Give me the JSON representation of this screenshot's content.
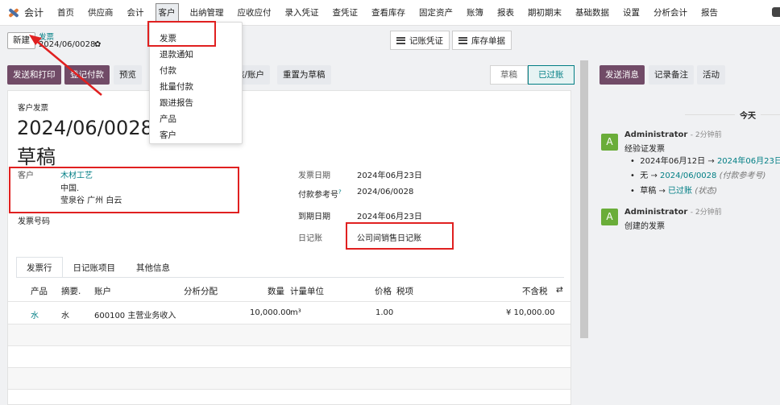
{
  "navbar": {
    "app_name": "会计",
    "items": [
      "首页",
      "供应商",
      "会计",
      "客户",
      "出纳管理",
      "应收应付",
      "录入凭证",
      "查凭证",
      "查看库存",
      "固定资产",
      "账簿",
      "报表",
      "期初期末",
      "基础数据",
      "设置",
      "分析会计",
      "报告"
    ]
  },
  "breadcrumb": {
    "new_label": "新建",
    "parent": "发票",
    "current": "2024/06/0028"
  },
  "top_buttons": {
    "voucher": "记账凭证",
    "stock": "库存单据"
  },
  "dropdown": {
    "items": [
      "发票",
      "退款通知",
      "付款",
      "批量付款",
      "跟进报告",
      "产品",
      "客户"
    ]
  },
  "actions": {
    "send_print": "发送和打印",
    "register_payment": "登记付款",
    "preview": "预览",
    "check_account": "核/账户",
    "reset_draft": "重置为草稿"
  },
  "status": {
    "draft": "草稿",
    "posted": "已过账"
  },
  "form": {
    "doc_type": "客户发票",
    "number": "2024/06/0028",
    "state": "草稿",
    "customer_label": "客户",
    "customer_name": "木材工艺",
    "customer_country": "中国.",
    "customer_address": "莹泉谷 广州 白云",
    "invoice_number_label": "发票号码",
    "invoice_date_label": "发票日期",
    "invoice_date": "2024年06月23日",
    "payment_ref_label": "付款参考号",
    "payment_ref_help": "?",
    "payment_ref": "2024/06/0028",
    "due_date_label": "到期日期",
    "due_date": "2024年06月23日",
    "journal_label": "日记账",
    "journal": "公司间销售日记账"
  },
  "tabs": [
    "发票行",
    "日记账项目",
    "其他信息"
  ],
  "table": {
    "headers": [
      "产品",
      "摘要.",
      "账户",
      "分析分配",
      "数量",
      "计量单位",
      "价格",
      "税项",
      "不含税"
    ],
    "rows": [
      {
        "product": "水",
        "desc": "水",
        "account": "600100 主营业务收入",
        "qty": "10,000.00",
        "uom": "m³",
        "price": "1.00",
        "subtotal": "¥ 10,000.00"
      }
    ]
  },
  "chatter": {
    "send_message": "发送消息",
    "log_note": "记录备注",
    "activity": "活动",
    "today": "今天",
    "messages": [
      {
        "avatar": "A",
        "author": "Administrator",
        "time": "- 2分钟前",
        "text": "经验证发票",
        "changes": [
          {
            "old": "2024年06月12日",
            "new": "2024年06月23日",
            "note": ""
          },
          {
            "old": "无",
            "new": "2024/06/0028",
            "note": "(付款参考号)"
          },
          {
            "old": "草稿",
            "new": "已过账",
            "note": "(状态)"
          }
        ]
      },
      {
        "avatar": "A",
        "author": "Administrator",
        "time": "- 2分钟前",
        "text": "创建的发票"
      }
    ]
  },
  "colors": {
    "primary": "#714b67",
    "link": "#017e84",
    "annotation_red": "#e02020",
    "avatar_green": "#6aad39"
  }
}
